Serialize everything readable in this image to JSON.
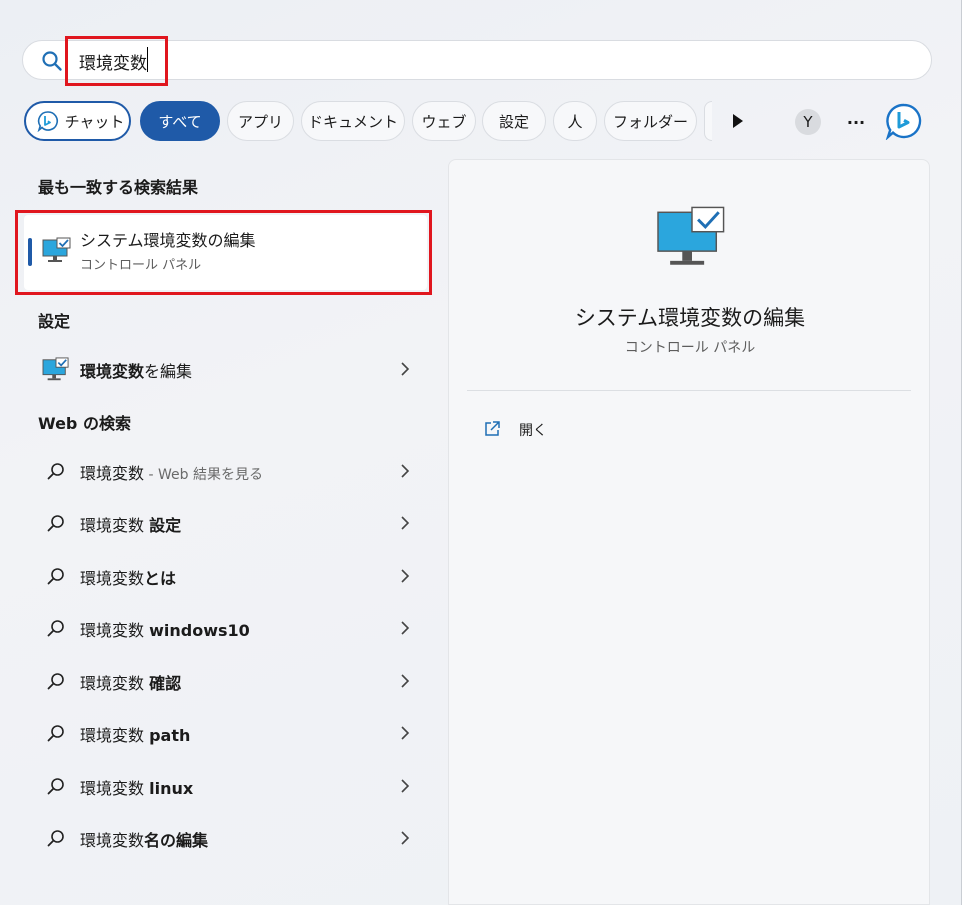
{
  "search": {
    "value": "環境変数",
    "placeholder": ""
  },
  "chips": [
    {
      "label": "チャット",
      "icon": "bing-chat-icon"
    },
    {
      "label": "すべて",
      "active": true
    },
    {
      "label": "アプリ"
    },
    {
      "label": "ドキュメント"
    },
    {
      "label": "ウェブ"
    },
    {
      "label": "設定"
    },
    {
      "label": "人"
    },
    {
      "label": "フォルダー"
    }
  ],
  "user_initial": "Y",
  "more_label": "···",
  "left": {
    "best_match_heading": "最も一致する検索結果",
    "best_match": {
      "title": "システム環境変数の編集",
      "subtitle": "コントロール パネル",
      "icon": "system-env-icon"
    },
    "settings_heading": "設定",
    "settings_item": {
      "bold": "環境変数",
      "rest": "を編集",
      "icon": "system-env-icon"
    },
    "web_heading": "Web の検索",
    "web_results": [
      {
        "prefix": "環境変数",
        "bold": "",
        "suffix": " - Web 結果を見る"
      },
      {
        "prefix": "環境変数 ",
        "bold": "設定",
        "suffix": ""
      },
      {
        "prefix": "環境変数",
        "bold": "とは",
        "suffix": ""
      },
      {
        "prefix": "環境変数 ",
        "bold": "windows10",
        "suffix": ""
      },
      {
        "prefix": "環境変数 ",
        "bold": "確認",
        "suffix": ""
      },
      {
        "prefix": "環境変数 ",
        "bold": "path",
        "suffix": ""
      },
      {
        "prefix": "環境変数 ",
        "bold": "linux",
        "suffix": ""
      },
      {
        "prefix": "環境変数",
        "bold": "名の編集",
        "suffix": ""
      }
    ]
  },
  "preview": {
    "title": "システム環境変数の編集",
    "subtitle": "コントロール パネル",
    "action_open": "開く"
  },
  "colors": {
    "accent": "#1f5aa8",
    "highlight": "#e0161e"
  }
}
